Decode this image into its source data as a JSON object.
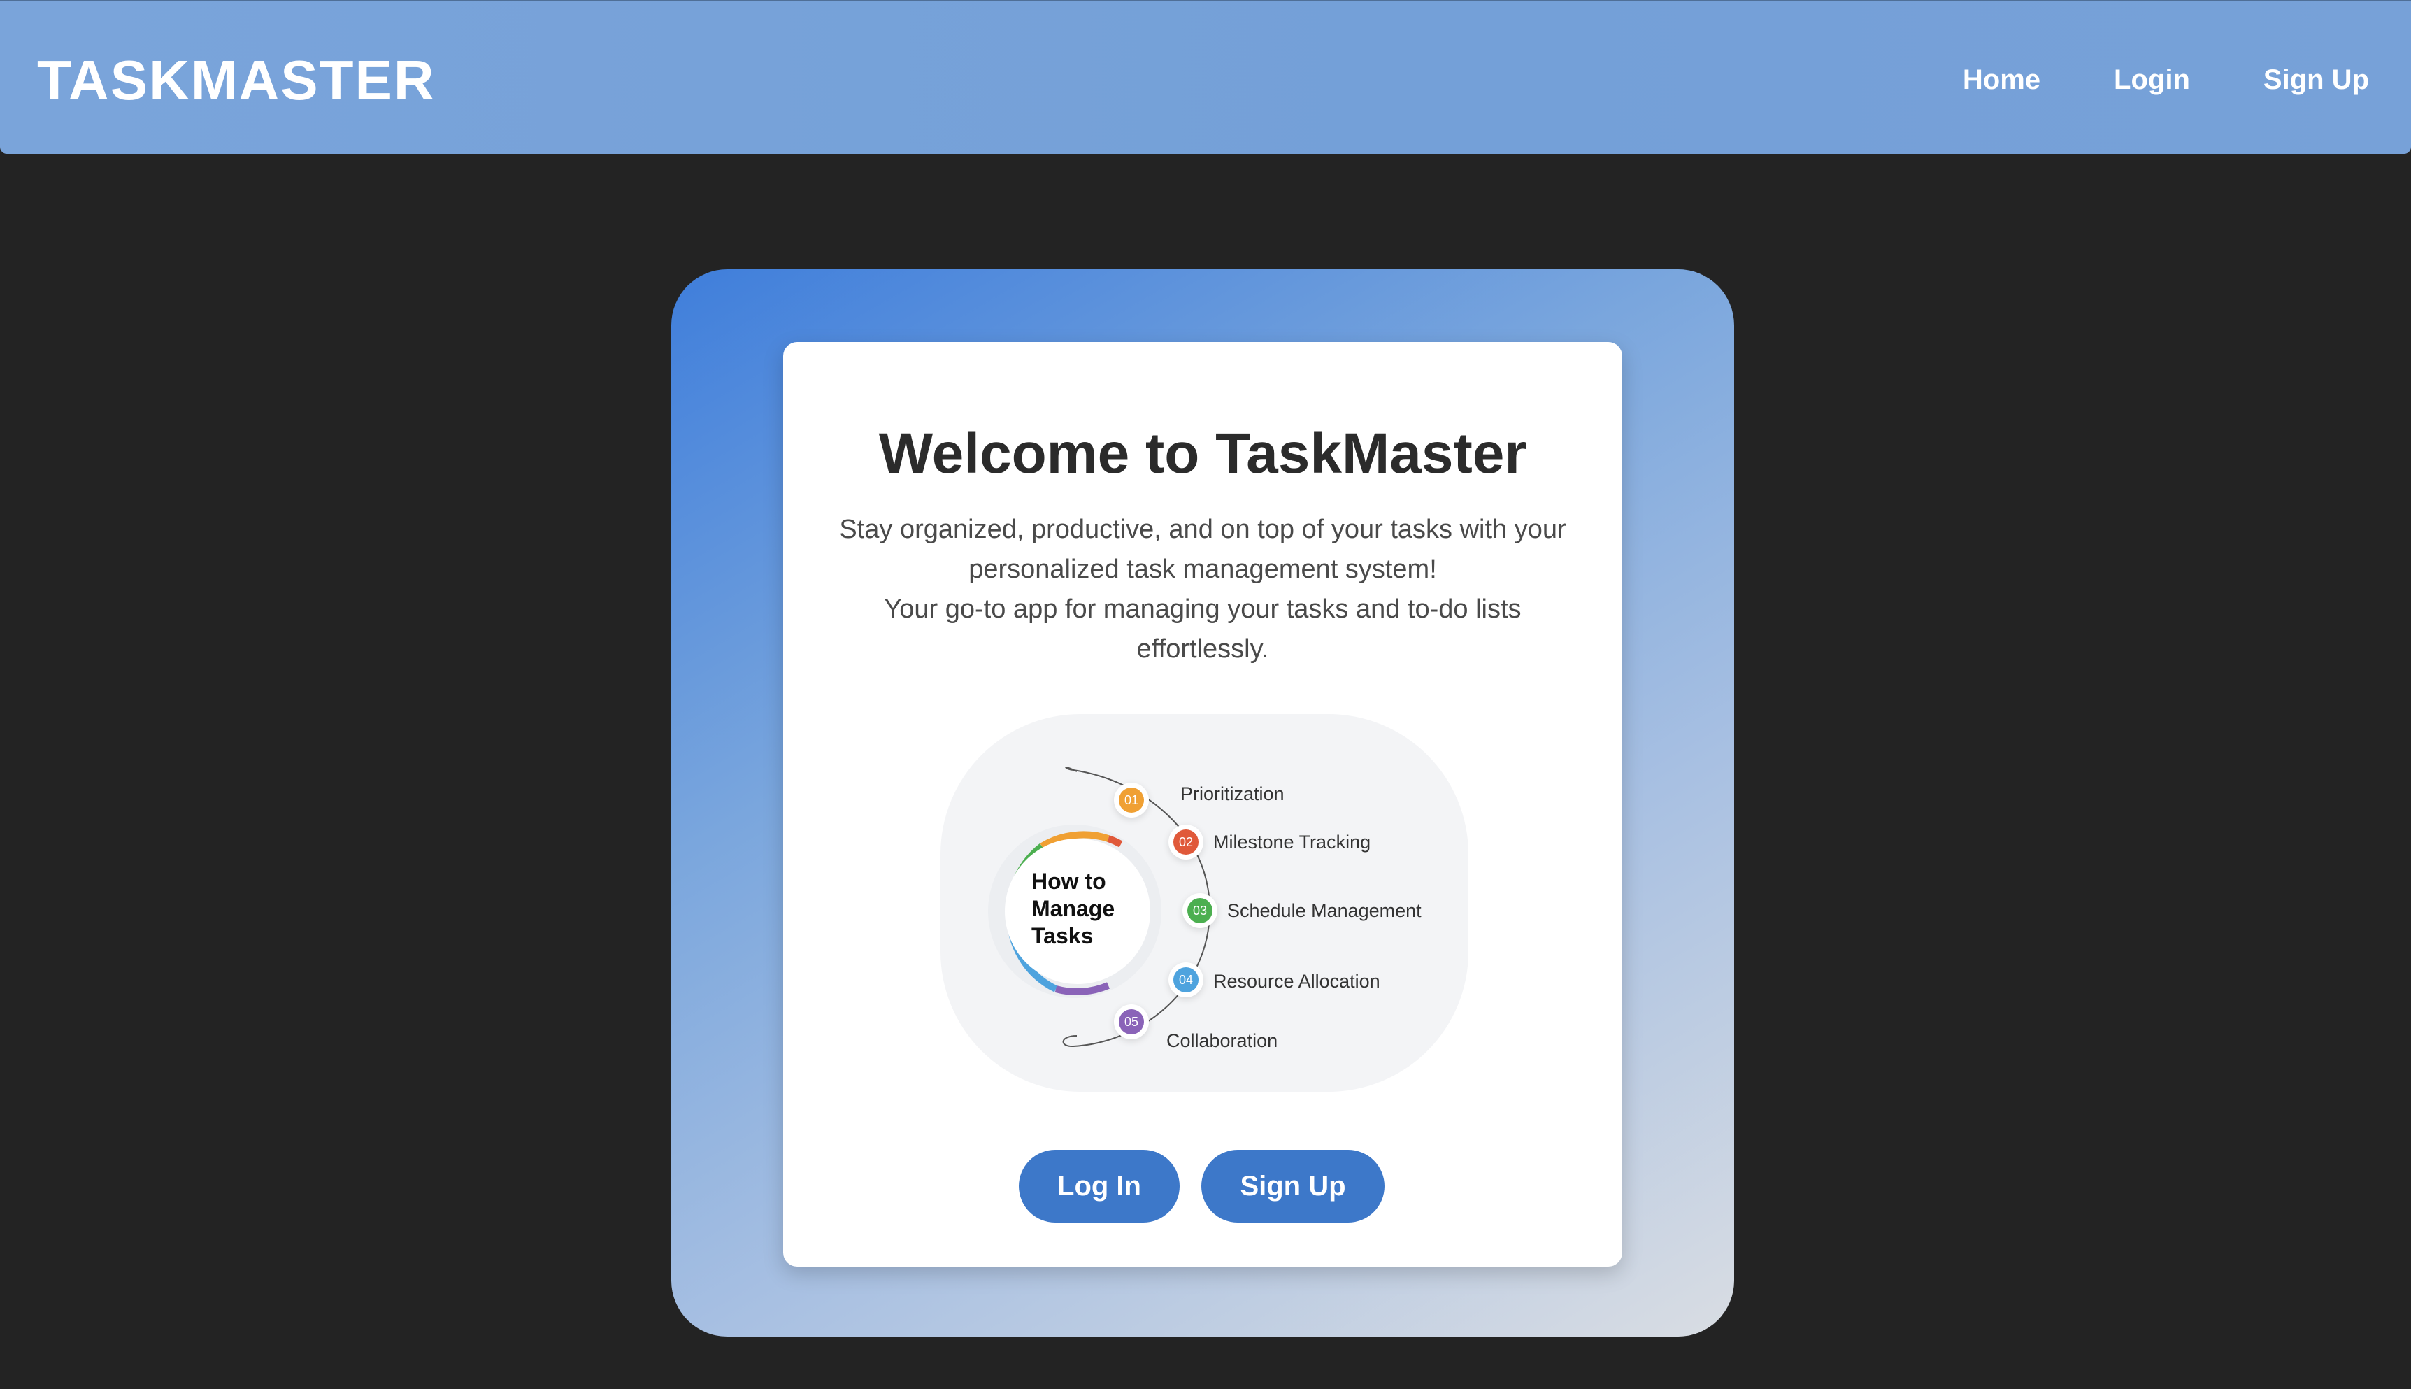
{
  "nav": {
    "brand": "TASKMASTER",
    "links": [
      "Home",
      "Login",
      "Sign Up"
    ]
  },
  "hero": {
    "title": "Welcome to TaskMaster",
    "text_line1": "Stay organized, productive, and on top of your tasks with your personalized task management system!",
    "text_line2": "Your go-to app for managing your tasks and to-do lists effortlessly.",
    "infographic": {
      "center_lines": [
        "How to",
        "Manage",
        "Tasks"
      ],
      "steps": [
        {
          "number": "01",
          "label": "Prioritization",
          "color": "#f0a033"
        },
        {
          "number": "02",
          "label": "Milestone Tracking",
          "color": "#e0593a"
        },
        {
          "number": "03",
          "label": "Schedule Management",
          "color": "#4caf50"
        },
        {
          "number": "04",
          "label": "Resource Allocation",
          "color": "#4ea3de"
        },
        {
          "number": "05",
          "label": "Collaboration",
          "color": "#8a63b8"
        }
      ]
    },
    "buttons": {
      "login": "Log In",
      "signup": "Sign Up"
    }
  },
  "colors": {
    "navbar": "#76a2d9",
    "background": "#232323",
    "button": "#3d78c9"
  }
}
